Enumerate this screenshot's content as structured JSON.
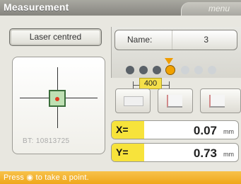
{
  "header": {
    "title": "Measurement",
    "menu_label": "menu"
  },
  "left": {
    "laser_button": "Laser centred",
    "serial": "BT: 10813725"
  },
  "right": {
    "name_label": "Name:",
    "name_value": "3",
    "distance": "400",
    "x_label": "X=",
    "x_value": "0.07",
    "x_unit": "mm",
    "y_label": "Y=",
    "y_value": "0.73",
    "y_unit": "mm"
  },
  "status": {
    "text": "Press",
    "icon": "camera-icon",
    "text2": "to take a point."
  },
  "colors": {
    "accent": "#f7e33b",
    "status_bar": "#efa71b",
    "dot_active": "#f1a200"
  }
}
